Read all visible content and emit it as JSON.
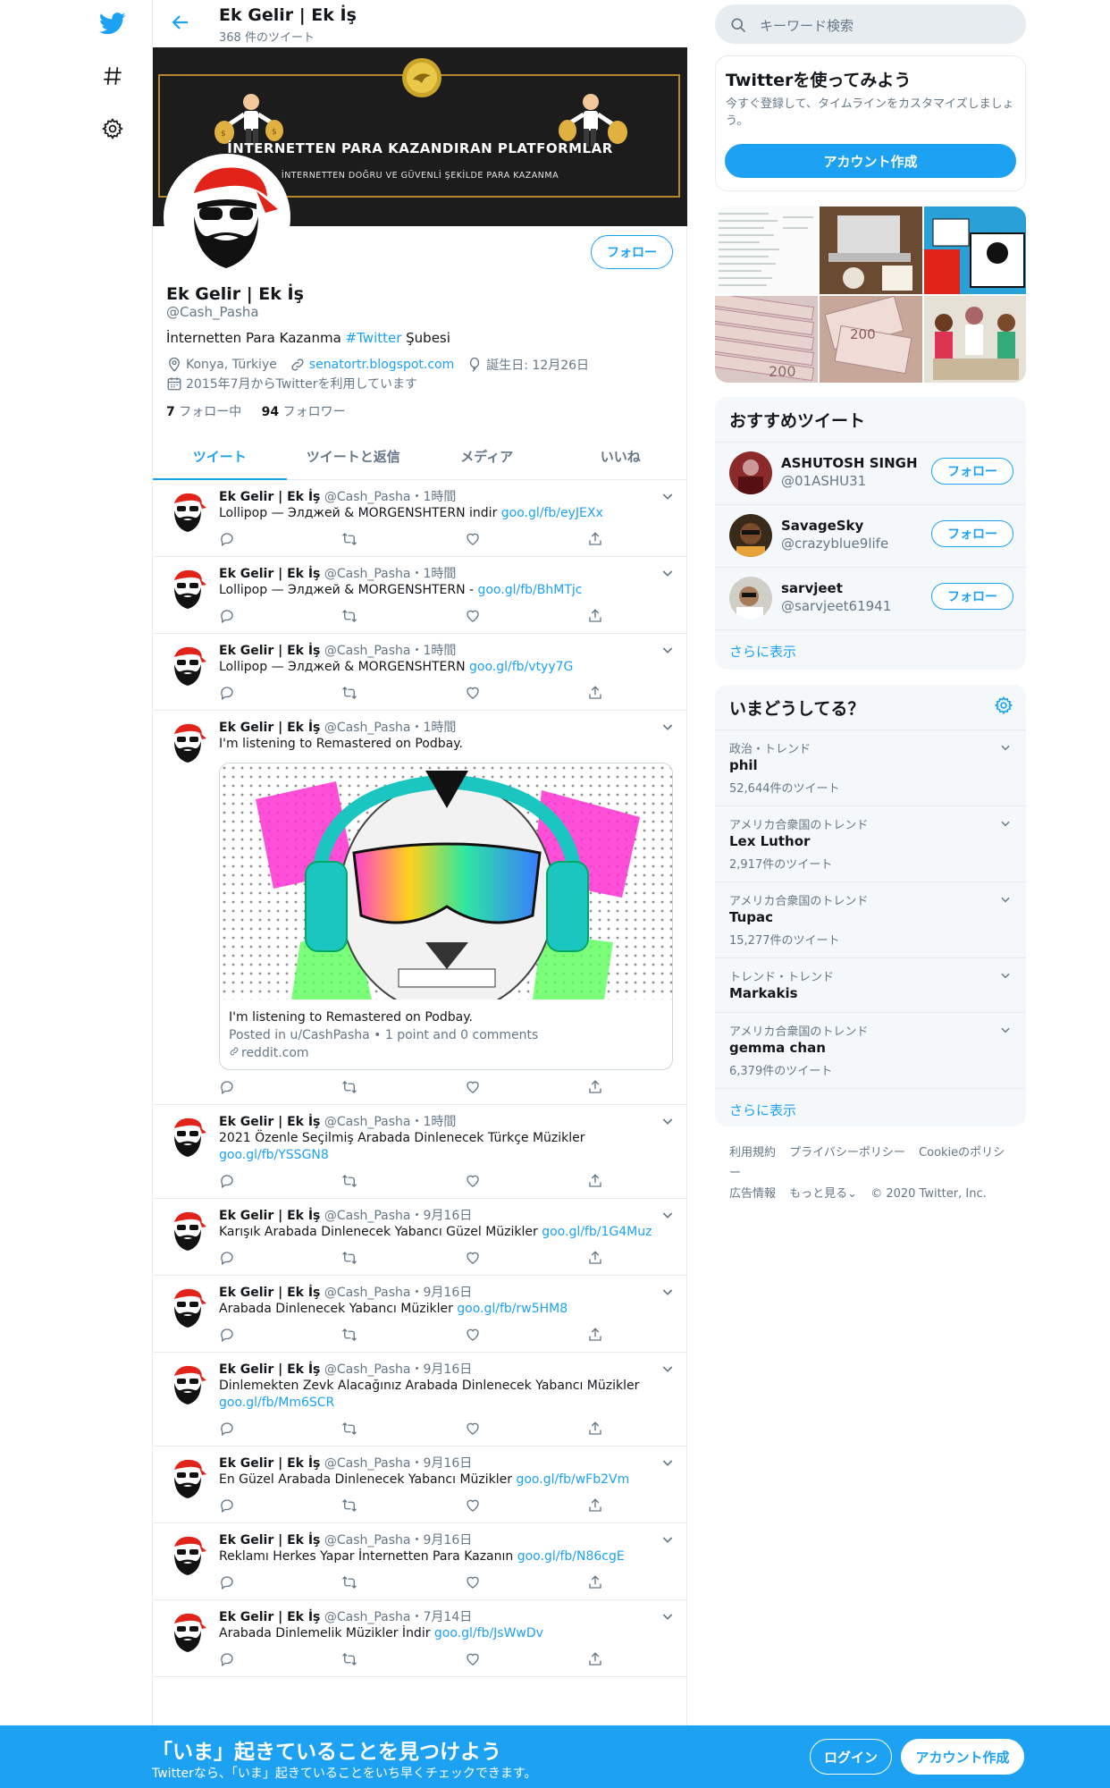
{
  "nav": {
    "logo": "twitter-bird-icon",
    "explore": "hashtag-icon",
    "settings": "gear-icon"
  },
  "topbar": {
    "name": "Ek Gelir | Ek İş",
    "tweet_count": "368 件のツイート"
  },
  "banner": {
    "title": "İNTERNETTEN PARA KAZANDIRAN PLATFORMLAR",
    "subtitle": "İNTERNETTEN DOĞRU VE GÜVENLİ ŞEKİLDE PARA KAZANMA"
  },
  "profile": {
    "follow_label": "フォロー",
    "name": "Ek Gelir | Ek İş",
    "handle": "@Cash_Pasha",
    "bio_before": "İnternetten Para Kazanma ",
    "bio_hashtag": "#Twitter",
    "bio_after": " Şubesi",
    "location": "Konya, Türkiye",
    "website": "senatortr.blogspot.com",
    "birthday": "誕生日: 12月26日",
    "joined": "2015年7月からTwitterを利用しています",
    "following_count": "7",
    "following_label": " フォロー中",
    "followers_count": "94",
    "followers_label": " フォロワー"
  },
  "tabs": [
    "ツイート",
    "ツイートと返信",
    "メディア",
    "いいね"
  ],
  "tweets": [
    {
      "name": "Ek Gelir | Ek İş",
      "meta": " @Cash_Pasha・1時間",
      "text": "Lollipop — Элджей & MORGENSHTERN indir ",
      "link": "goo.gl/fb/eyJEXx"
    },
    {
      "name": "Ek Gelir | Ek İş",
      "meta": " @Cash_Pasha・1時間",
      "text": "Lollipop — Элджей & MORGENSHTERN - ",
      "link": "goo.gl/fb/BhMTjc"
    },
    {
      "name": "Ek Gelir | Ek İş",
      "meta": " @Cash_Pasha・1時間",
      "text": "Lollipop — Элджей & MORGENSHTERN ",
      "link": "goo.gl/fb/vtyy7G"
    },
    {
      "name": "Ek Gelir | Ek İş",
      "meta": " @Cash_Pasha・1時間",
      "text": "I'm listening to Remastered on Podbay.",
      "link": "",
      "card": {
        "title": "I'm listening to Remastered on Podbay.",
        "desc": "Posted in u/CashPasha • 1 point and 0 comments",
        "domain": "reddit.com"
      }
    },
    {
      "name": "Ek Gelir | Ek İş",
      "meta": " @Cash_Pasha・1時間",
      "text": "2021 Özenle Seçilmiş Arabada Dinlenecek Türkçe Müzikler ",
      "link": "goo.gl/fb/YSSGN8"
    },
    {
      "name": "Ek Gelir | Ek İş",
      "meta": " @Cash_Pasha・9月16日",
      "text": "Karışık Arabada Dinlenecek Yabancı Güzel Müzikler ",
      "link": "goo.gl/fb/1G4Muz"
    },
    {
      "name": "Ek Gelir | Ek İş",
      "meta": " @Cash_Pasha・9月16日",
      "text": "Arabada Dinlenecek Yabancı Müzikler ",
      "link": "goo.gl/fb/rw5HM8"
    },
    {
      "name": "Ek Gelir | Ek İş",
      "meta": " @Cash_Pasha・9月16日",
      "text": "Dinlemekten Zevk Alacağınız Arabada Dinlenecek Yabancı Müzikler ",
      "link": "goo.gl/fb/Mm6SCR"
    },
    {
      "name": "Ek Gelir | Ek İş",
      "meta": " @Cash_Pasha・9月16日",
      "text": "En Güzel Arabada Dinlenecek Yabancı Müzikler ",
      "link": "goo.gl/fb/wFb2Vm"
    },
    {
      "name": "Ek Gelir | Ek İş",
      "meta": " @Cash_Pasha・9月16日",
      "text": "Reklamı Herkes Yapar İnternetten Para Kazanın ",
      "link": "goo.gl/fb/N86cgE"
    },
    {
      "name": "Ek Gelir | Ek İş",
      "meta": " @Cash_Pasha・7月14日",
      "text": "Arabada Dinlemelik Müzikler İndir ",
      "link": "goo.gl/fb/JsWwDv"
    }
  ],
  "search": {
    "placeholder": "キーワード検索"
  },
  "signup_box": {
    "title": "Twitterを使ってみよう",
    "desc": "今すぐ登録して、タイムラインをカスタマイズしましょう。",
    "button": "アカウント作成"
  },
  "photo_grid": {
    "cells": [
      "200",
      "200"
    ]
  },
  "who_to_follow": {
    "title": "おすすめツイート",
    "users": [
      {
        "name": "ASHUTOSH SINGH",
        "handle": "@01ASHU31"
      },
      {
        "name": "SavageSky",
        "handle": "@crazyblue9life"
      },
      {
        "name": "sarvjeet",
        "handle": "@sarvjeet61941"
      }
    ],
    "follow_label": "フォロー",
    "more": "さらに表示"
  },
  "trends": {
    "title": "いまどうしてる？",
    "items": [
      {
        "category": "政治・トレンド",
        "name": "phil",
        "count": "52,644件のツイート"
      },
      {
        "category": "アメリカ合衆国のトレンド",
        "name": "Lex Luthor",
        "count": "2,917件のツイート"
      },
      {
        "category": "アメリカ合衆国のトレンド",
        "name": "Tupac",
        "count": "15,277件のツイート"
      },
      {
        "category": "トレンド・トレンド",
        "name": "Markakis",
        "count": ""
      },
      {
        "category": "アメリカ合衆国のトレンド",
        "name": "gemma chan",
        "count": "6,379件のツイート"
      }
    ],
    "more": "さらに表示"
  },
  "footer": {
    "links": [
      "利用規約",
      "プライバシーポリシー",
      "Cookieのポリシー",
      "広告情報",
      "もっと見る⌄",
      "© 2020 Twitter, Inc."
    ]
  },
  "bottom_bar": {
    "title": "「いま」起きていることを見つけよう",
    "subtitle": "Twitterなら、「いま」起きていることをいち早くチェックできます。",
    "login": "ログイン",
    "signup": "アカウント作成"
  },
  "colors": {
    "accent": "#1da1f2",
    "text": "#14171a",
    "muted": "#657786",
    "border": "#e6ecf0"
  }
}
